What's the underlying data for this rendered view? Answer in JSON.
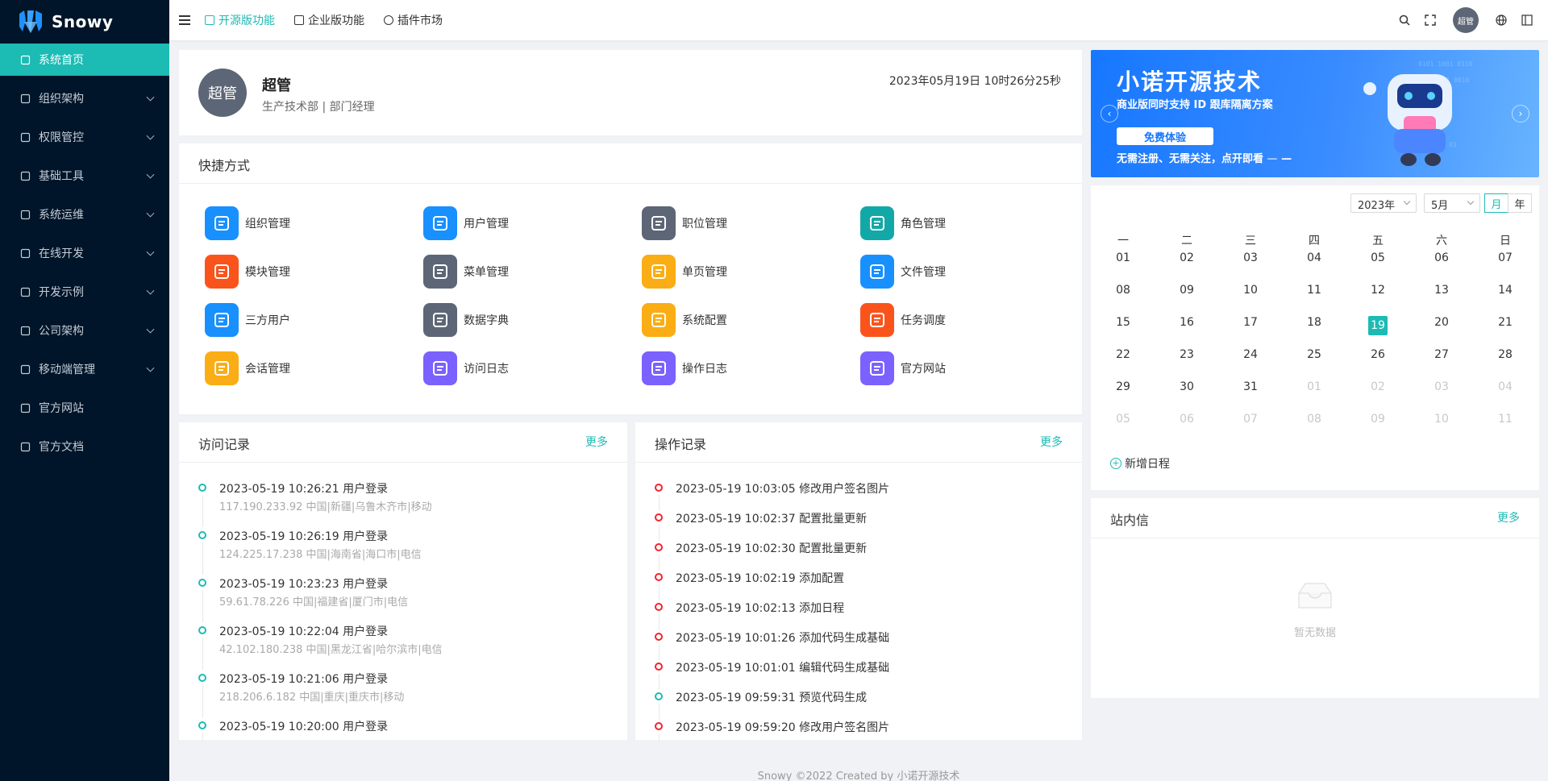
{
  "brand": {
    "name": "Snowy"
  },
  "sidebar": {
    "items": [
      {
        "label": "系统首页",
        "active": true,
        "icon": "home-icon",
        "expandable": false
      },
      {
        "label": "组织架构",
        "icon": "org-icon",
        "expandable": true
      },
      {
        "label": "权限管控",
        "icon": "user-icon",
        "expandable": true
      },
      {
        "label": "基础工具",
        "icon": "tool-icon",
        "expandable": true
      },
      {
        "label": "系统运维",
        "icon": "server-icon",
        "expandable": true
      },
      {
        "label": "在线开发",
        "icon": "code-icon",
        "expandable": true
      },
      {
        "label": "开发示例",
        "icon": "layout-icon",
        "expandable": true
      },
      {
        "label": "公司架构",
        "icon": "building-icon",
        "expandable": true
      },
      {
        "label": "移动端管理",
        "icon": "mobile-icon",
        "expandable": true
      },
      {
        "label": "官方网站",
        "icon": "registered-icon",
        "expandable": false
      },
      {
        "label": "官方文档",
        "icon": "doc-icon",
        "expandable": false
      }
    ]
  },
  "header": {
    "tabs": [
      {
        "label": "开源版功能",
        "active": true
      },
      {
        "label": "企业版功能"
      },
      {
        "label": "插件市场"
      }
    ],
    "avatar_text": "超管"
  },
  "user": {
    "avatar_text": "超管",
    "name": "超管",
    "dept": "生产技术部 | 部门经理",
    "time": "2023年05月19日 10时26分25秒"
  },
  "shortcuts": {
    "title": "快捷方式",
    "items": [
      {
        "label": "组织管理",
        "color": "#1890ff",
        "icon": "org-icon"
      },
      {
        "label": "用户管理",
        "color": "#1890ff",
        "icon": "user-icon"
      },
      {
        "label": "职位管理",
        "color": "#5d6676",
        "icon": "org-icon"
      },
      {
        "label": "角色管理",
        "color": "#13a8a8",
        "icon": "share-icon"
      },
      {
        "label": "模块管理",
        "color": "#fa541c",
        "icon": "appstore-icon"
      },
      {
        "label": "菜单管理",
        "color": "#5d6676",
        "icon": "menu-icon"
      },
      {
        "label": "单页管理",
        "color": "#faad14",
        "icon": "page-icon"
      },
      {
        "label": "文件管理",
        "color": "#1890ff",
        "icon": "copy-icon"
      },
      {
        "label": "三方用户",
        "color": "#1890ff",
        "icon": "team-icon"
      },
      {
        "label": "数据字典",
        "color": "#5d6676",
        "icon": "search-doc-icon"
      },
      {
        "label": "系统配置",
        "color": "#faad14",
        "icon": "gear-icon"
      },
      {
        "label": "任务调度",
        "color": "#fa541c",
        "icon": "clock-icon"
      },
      {
        "label": "会话管理",
        "color": "#faad14",
        "icon": "user-minus-icon"
      },
      {
        "label": "访问日志",
        "color": "#7b61ff",
        "icon": "list-icon"
      },
      {
        "label": "操作日志",
        "color": "#7b61ff",
        "icon": "list-icon"
      },
      {
        "label": "官方网站",
        "color": "#7b61ff",
        "icon": "registered-icon"
      }
    ]
  },
  "visit_log": {
    "title": "访问记录",
    "more": "更多",
    "items": [
      {
        "main": "2023-05-19 10:26:21 用户登录",
        "sub": "117.190.233.92 中国|新疆|乌鲁木齐市|移动"
      },
      {
        "main": "2023-05-19 10:26:19 用户登录",
        "sub": "124.225.17.238 中国|海南省|海口市|电信"
      },
      {
        "main": "2023-05-19 10:23:23 用户登录",
        "sub": "59.61.78.226 中国|福建省|厦门市|电信"
      },
      {
        "main": "2023-05-19 10:22:04 用户登录",
        "sub": "42.102.180.238 中国|黑龙江省|哈尔滨市|电信"
      },
      {
        "main": "2023-05-19 10:21:06 用户登录",
        "sub": "218.206.6.182 中国|重庆|重庆市|移动"
      },
      {
        "main": "2023-05-19 10:20:00 用户登录",
        "sub": ""
      }
    ]
  },
  "op_log": {
    "title": "操作记录",
    "more": "更多",
    "items": [
      {
        "main": "2023-05-19 10:03:05 修改用户签名图片",
        "status": "red"
      },
      {
        "main": "2023-05-19 10:02:37 配置批量更新",
        "status": "red"
      },
      {
        "main": "2023-05-19 10:02:30 配置批量更新",
        "status": "red"
      },
      {
        "main": "2023-05-19 10:02:19 添加配置",
        "status": "red"
      },
      {
        "main": "2023-05-19 10:02:13 添加日程",
        "status": "red"
      },
      {
        "main": "2023-05-19 10:01:26 添加代码生成基础",
        "status": "red"
      },
      {
        "main": "2023-05-19 10:01:01 编辑代码生成基础",
        "status": "red"
      },
      {
        "main": "2023-05-19 09:59:31 预览代码生成",
        "status": "green"
      },
      {
        "main": "2023-05-19 09:59:20 修改用户签名图片",
        "status": "red"
      }
    ]
  },
  "banner": {
    "title": "小诺开源技术",
    "subtitle": "商业版同时支持 ID 跟库隔离方案",
    "button": "免费体验",
    "footer": "无需注册、无需关注，点开即看"
  },
  "calendar": {
    "year_select": "2023年",
    "month_select": "5月",
    "mode_month": "月",
    "mode_year": "年",
    "weekdays": [
      "一",
      "二",
      "三",
      "四",
      "五",
      "六",
      "日"
    ],
    "days": [
      [
        "01",
        "02",
        "03",
        "04",
        "05",
        "06",
        "07"
      ],
      [
        "08",
        "09",
        "10",
        "11",
        "12",
        "13",
        "14"
      ],
      [
        "15",
        "16",
        "17",
        "18",
        "19",
        "20",
        "21"
      ],
      [
        "22",
        "23",
        "24",
        "25",
        "26",
        "27",
        "28"
      ],
      [
        "29",
        "30",
        "31",
        "01",
        "02",
        "03",
        "04"
      ],
      [
        "05",
        "06",
        "07",
        "08",
        "09",
        "10",
        "11"
      ]
    ],
    "today": "19",
    "add_label": "新增日程"
  },
  "messages": {
    "title": "站内信",
    "more": "更多",
    "empty": "暂无数据"
  },
  "footer": {
    "text": "Snowy ©2022 Created by 小诺开源技术"
  }
}
